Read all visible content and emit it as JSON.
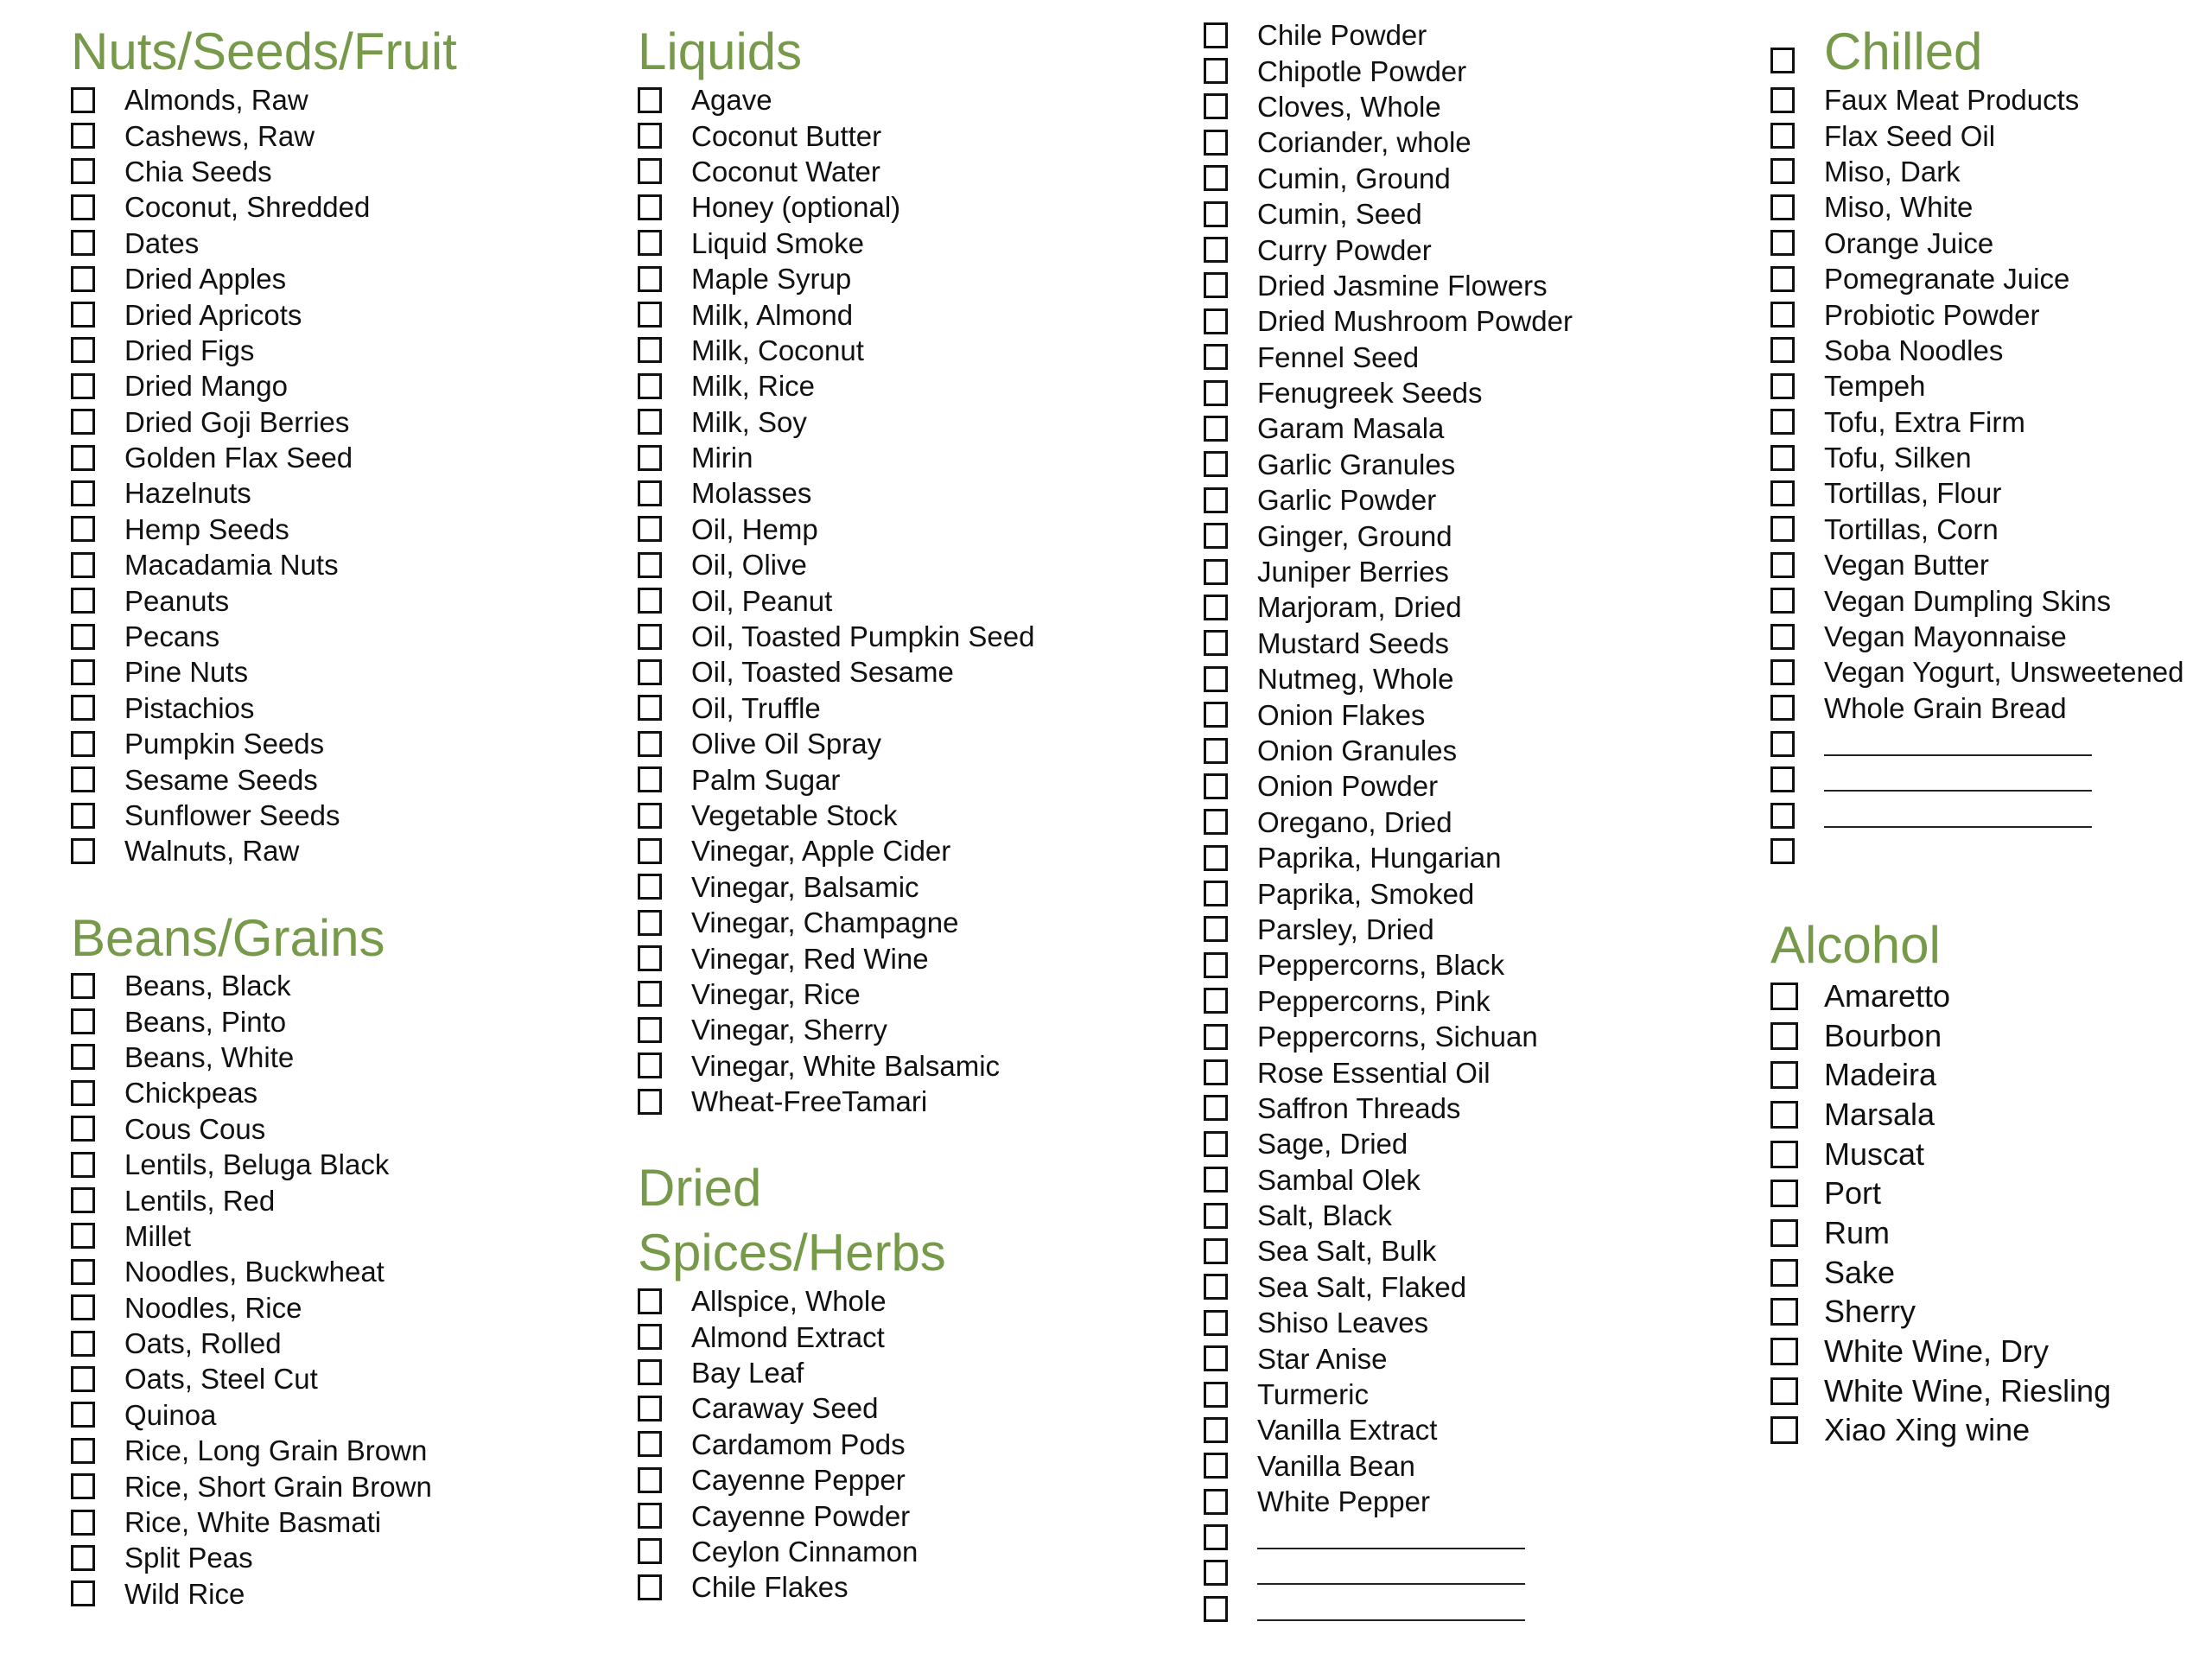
{
  "accent_color": "#77994a",
  "columns": [
    {
      "sections": [
        {
          "title": "Nuts/Seeds/Fruit",
          "items": [
            "Almonds, Raw",
            "Cashews, Raw",
            "Chia Seeds",
            "Coconut, Shredded",
            "Dates",
            "Dried Apples",
            "Dried Apricots",
            "Dried Figs",
            "Dried Mango",
            "Dried Goji Berries",
            "Golden Flax Seed",
            "Hazelnuts",
            "Hemp Seeds",
            "Macadamia Nuts",
            "Peanuts",
            "Pecans",
            "Pine Nuts",
            "Pistachios",
            "Pumpkin Seeds",
            "Sesame Seeds",
            "Sunflower Seeds",
            "Walnuts, Raw"
          ]
        },
        {
          "title": "Beans/Grains",
          "items": [
            "Beans, Black",
            "Beans, Pinto",
            "Beans, White",
            "Chickpeas",
            "Cous Cous",
            "Lentils, Beluga Black",
            "Lentils, Red",
            "Millet",
            "Noodles, Buckwheat",
            "Noodles, Rice",
            "Oats, Rolled",
            "Oats, Steel Cut",
            "Quinoa",
            "Rice, Long Grain Brown",
            "Rice, Short Grain Brown",
            "Rice,  White Basmati",
            "Split Peas",
            "Wild Rice"
          ]
        }
      ]
    },
    {
      "sections": [
        {
          "title": "Liquids",
          "items": [
            "Agave",
            "Coconut Butter",
            "Coconut Water",
            "Honey (optional)",
            "Liquid Smoke",
            "Maple Syrup",
            "Milk, Almond",
            "Milk, Coconut",
            "Milk, Rice",
            "Milk, Soy",
            "Mirin",
            "Molasses",
            "Oil, Hemp",
            "Oil, Olive",
            "Oil, Peanut",
            "Oil, Toasted Pumpkin Seed",
            "Oil, Toasted Sesame",
            "Oil, Truffle",
            "Olive Oil Spray",
            "Palm Sugar",
            "Vegetable Stock",
            "Vinegar, Apple Cider",
            "Vinegar, Balsamic",
            "Vinegar, Champagne",
            "Vinegar, Red Wine",
            "Vinegar, Rice",
            "Vinegar, Sherry",
            "Vinegar, White Balsamic",
            "Wheat-FreeTamari"
          ]
        },
        {
          "title_line1": "Dried",
          "title_line2": "Spices/Herbs",
          "items": [
            "Allspice, Whole",
            "Almond Extract",
            "Bay Leaf",
            "Caraway Seed",
            "Cardamom Pods",
            "Cayenne Pepper",
            "Cayenne Powder",
            "Ceylon Cinnamon",
            "Chile Flakes"
          ]
        }
      ]
    },
    {
      "sections": [
        {
          "items": [
            "Chile Powder",
            "Chipotle Powder",
            "Cloves, Whole",
            "Coriander, whole",
            "Cumin, Ground",
            "Cumin, Seed",
            "Curry Powder",
            "Dried Jasmine Flowers",
            "Dried Mushroom Powder",
            "Fennel Seed",
            "Fenugreek Seeds",
            "Garam Masala",
            "Garlic Granules",
            "Garlic Powder",
            "Ginger, Ground",
            "Juniper Berries",
            "Marjoram, Dried",
            "Mustard Seeds",
            "Nutmeg, Whole",
            "Onion Flakes",
            "Onion Granules",
            "Onion Powder",
            "Oregano, Dried",
            "Paprika, Hungarian",
            "Paprika, Smoked",
            "Parsley, Dried",
            "Peppercorns, Black",
            "Peppercorns, Pink",
            "Peppercorns, Sichuan",
            "Rose Essential Oil",
            "Saffron Threads",
            "Sage, Dried",
            "Sambal Olek",
            "Salt, Black",
            "Sea Salt, Bulk",
            "Sea Salt, Flaked",
            "Shiso Leaves",
            "Star Anise",
            "Turmeric",
            "Vanilla Extract",
            "Vanilla Bean",
            "White Pepper",
            "",
            "",
            ""
          ]
        }
      ]
    },
    {
      "sections": [
        {
          "title": "Chilled",
          "items": [
            "Faux Meat Products",
            "Flax Seed Oil",
            "Miso, Dark",
            "Miso, White",
            "Orange Juice",
            "Pomegranate Juice",
            "Probiotic Powder",
            "Soba Noodles",
            "Tempeh",
            "Tofu, Extra Firm",
            "Tofu, Silken",
            "Tortillas, Flour",
            "Tortillas, Corn",
            "Vegan Butter",
            "Vegan Dumpling Skins",
            "Vegan Mayonnaise",
            "Vegan Yogurt, Unsweetened",
            "Whole Grain Bread",
            "",
            "",
            "",
            null
          ]
        },
        {
          "title": "Alcohol",
          "items": [
            "Amaretto",
            "Bourbon",
            "Madeira",
            "Marsala",
            "Muscat",
            "Port",
            "Rum",
            "Sake",
            "Sherry",
            "White Wine, Dry",
            "White Wine, Riesling",
            "Xiao Xing wine"
          ]
        }
      ]
    }
  ]
}
